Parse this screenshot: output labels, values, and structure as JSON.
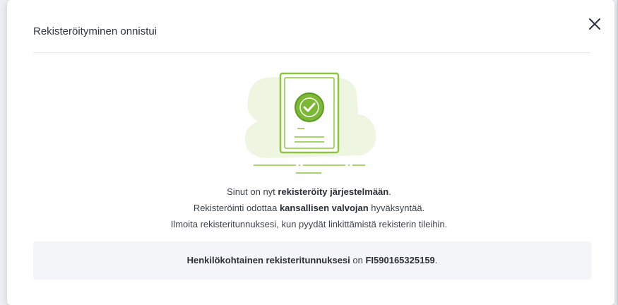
{
  "modal": {
    "title": "Rekisteröityminen onnistui",
    "close_icon": "close-icon"
  },
  "illustration": {
    "icon": "document-check-icon",
    "colors": {
      "accent": "#8cc63f",
      "check_fill": "#7bb834",
      "blob": "#eef6e2"
    }
  },
  "messages": {
    "line1": {
      "prefix": "Sinut on nyt ",
      "bold": "rekisteröity järjestelmään",
      "suffix": "."
    },
    "line2": {
      "prefix": "Rekisteröinti odottaa ",
      "bold": "kansallisen valvojan",
      "suffix": " hyväksyntää."
    },
    "line3": "Ilmoita rekisteritunnuksesi, kun pyydät linkittämistä rekisterin tileihin."
  },
  "registry_id": {
    "label": "Henkilökohtainen rekisteritunnuksesi",
    "connector": " on ",
    "value": "FI590165325159",
    "suffix": "."
  }
}
